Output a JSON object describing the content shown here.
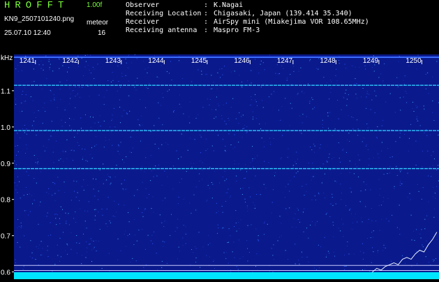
{
  "header": {
    "app_title": "HROFFT",
    "version": "1.00f",
    "filename": "KN9_2507101240.png",
    "datetime": "25.07.10 12:40",
    "meteor_label": "meteor",
    "meteor_count": "16"
  },
  "station": {
    "rows": [
      {
        "key": "Observer",
        "value": "K.Nagai"
      },
      {
        "key": "Receiving Location",
        "value": "Chigasaki, Japan (139.414 35.340)"
      },
      {
        "key": "Receiver",
        "value": "AirSpy mini (Miakejima VOR 108.65MHz)"
      },
      {
        "key": "Receiving antenna",
        "value": "Maspro FM-3"
      }
    ]
  },
  "colors": {
    "background": "#000000",
    "spectrogram": "#0a1a8c",
    "accent_green": "#7cff3a",
    "noise_floor": "#00e5ff"
  },
  "chart_data": {
    "type": "heatmap",
    "ylabel": "kHz",
    "y_ticks": [
      1.1,
      1.0,
      0.9,
      0.8,
      0.7,
      0.6
    ],
    "ylim": [
      0.58,
      1.2
    ],
    "x_ticks": [
      1241,
      1242,
      1243,
      1244,
      1245,
      1246,
      1247,
      1248,
      1249,
      1250
    ],
    "xlim": [
      1240.5,
      1250.4
    ],
    "carrier_lines_khz": [
      1.115,
      0.99,
      0.885
    ],
    "reference_lines_khz": [
      0.618,
      0.604
    ],
    "echo_trace": {
      "x": [
        1248.75,
        1248.85,
        1248.95,
        1249.05,
        1249.15,
        1249.25,
        1249.35,
        1249.45,
        1249.55,
        1249.65,
        1249.75,
        1249.85,
        1249.95,
        1250.05,
        1250.15,
        1250.25,
        1250.35
      ],
      "y": [
        0.59,
        0.6,
        0.61,
        0.605,
        0.615,
        0.62,
        0.625,
        0.62,
        0.635,
        0.64,
        0.635,
        0.65,
        0.66,
        0.655,
        0.675,
        0.69,
        0.71
      ]
    }
  }
}
